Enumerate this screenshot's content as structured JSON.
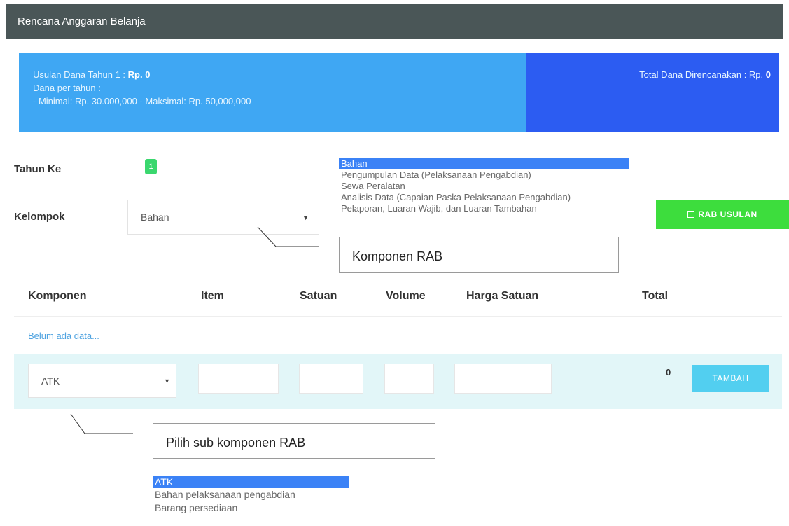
{
  "header": {
    "title": "Rencana Anggaran Belanja"
  },
  "summary": {
    "usulan_label": "Usulan Dana Tahun 1 : ",
    "usulan_value": "Rp. 0",
    "per_year_label": "Dana per tahun :",
    "min_max": "- Minimal: Rp. 30.000,000   - Maksimal: Rp. 50,000,000",
    "total_label": "Total Dana Direncanakan : Rp. ",
    "total_value": "0"
  },
  "form": {
    "tahun_label": "Tahun Ke",
    "tahun_value": "1",
    "kelompok_label": "Kelompok",
    "kelompok_value": "Bahan"
  },
  "kelompok_options": [
    "Bahan",
    "Pengumpulan Data (Pelaksanaan Pengabdian)",
    "Sewa Peralatan",
    "Analisis Data (Capaian Paska Pelaksanaan Pengabdian)",
    "Pelaporan, Luaran Wajib, dan Luaran Tambahan"
  ],
  "callouts": {
    "komponen": "Komponen RAB",
    "sub_komponen": "Pilih sub komponen RAB"
  },
  "rab_button": "RAB USULAN",
  "table": {
    "headers": [
      "Komponen",
      "Item",
      "Satuan",
      "Volume",
      "Harga Satuan",
      "Total"
    ],
    "empty": "Belum ada data...",
    "komponen_value": "ATK",
    "row_total": "0",
    "add_button": "TAMBAH"
  },
  "komponen_options": [
    "ATK",
    "Bahan pelaksanaan pengabdian",
    "Barang persediaan"
  ],
  "colors": {
    "titlebar": "#4a5657",
    "summary_left": "#3fa7f3",
    "summary_right": "#2c5cf2",
    "success": "#3ddd3d",
    "info": "#52cff0",
    "row_bg": "#e2f6f8",
    "selected_option": "#3b82f6"
  }
}
